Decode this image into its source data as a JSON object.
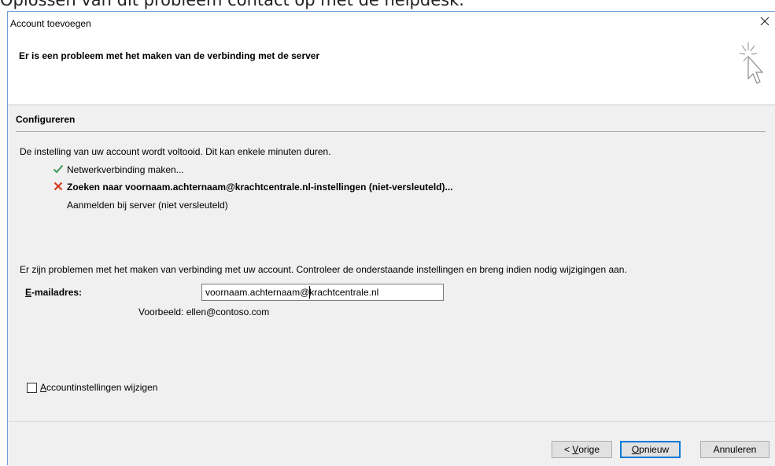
{
  "background": {
    "partial_text": "Oplossen van dit probleem contact op met de helpdesk."
  },
  "window": {
    "title": "Account toevoegen",
    "close_icon": "close-icon"
  },
  "header": {
    "title": "Er is een probleem met het maken van de verbinding met de server",
    "icon": "wizard-cursor-icon"
  },
  "section": {
    "title": "Configureren",
    "intro": "De instelling van uw account wordt voltooid. Dit kan enkele minuten duren.",
    "steps": [
      {
        "status": "done",
        "icon": "checkmark-icon",
        "label": "Netwerkverbinding maken..."
      },
      {
        "status": "error",
        "icon": "error-x-icon",
        "label": "Zoeken naar voornaam.achternaam@krachtcentrale.nl-instellingen (niet-versleuteld)..."
      },
      {
        "status": "pending",
        "icon": "",
        "label": "Aanmelden bij server (niet versleuteld)"
      }
    ]
  },
  "form": {
    "message": "Er zijn problemen met het maken van verbinding met uw account. Controleer de onderstaande instellingen en breng indien nodig wijzigingen aan.",
    "email_label_first": "E",
    "email_label_rest": "-mailadres:",
    "email_value": "voornaam.achternaam@krachtcentrale.nl",
    "example": "Voorbeeld: ellen@contoso.com"
  },
  "change_settings": {
    "checked": false,
    "label_first": "A",
    "label_rest": "ccountinstellingen wijzigen"
  },
  "buttons": {
    "prev_prefix": "< ",
    "prev_accel": "V",
    "prev_rest": "orige",
    "retry_accel": "O",
    "retry_rest": "pnieuw",
    "cancel": "Annuleren"
  },
  "colors": {
    "accent": "#0078d7",
    "success": "#3c9b5a",
    "error": "#d13c1f"
  }
}
